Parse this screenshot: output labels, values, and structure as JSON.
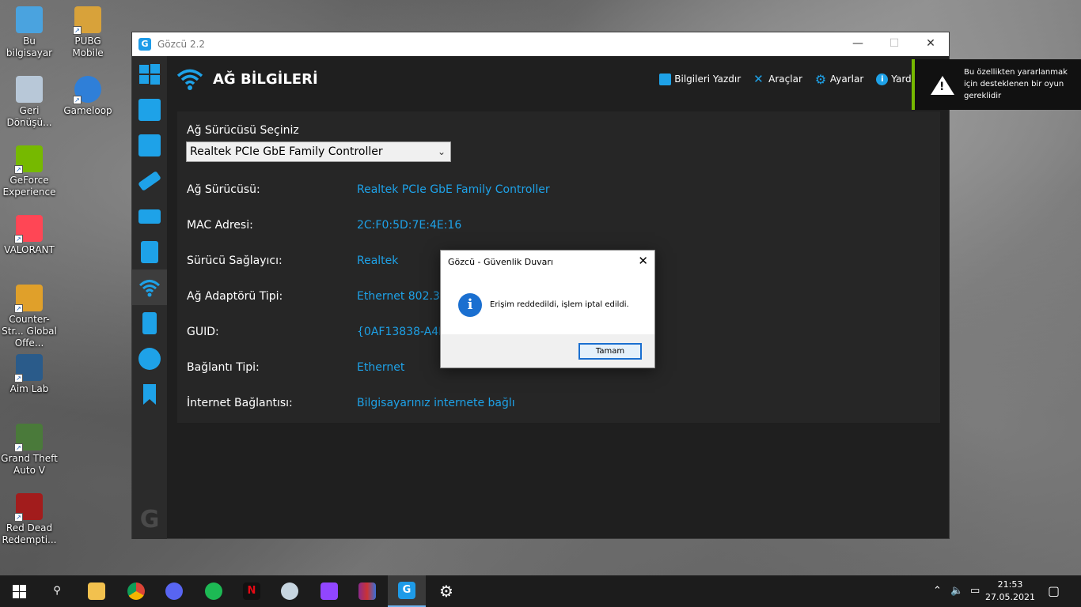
{
  "desktop": {
    "icons": [
      {
        "label": "Bu bilgisayar",
        "color": "#4aa3df"
      },
      {
        "label": "PUBG Mobile",
        "color": "#d8a23a"
      },
      {
        "label": "Geri Dönüşü...",
        "color": "#b8c8d8"
      },
      {
        "label": "Gameloop",
        "color": "#2f7fd8"
      },
      {
        "label": "GeForce Experience",
        "color": "#76b900"
      },
      {
        "label": "VALORANT",
        "color": "#ff4655"
      },
      {
        "label": "Counter-Str... Global Offe...",
        "color": "#e0a02a"
      },
      {
        "label": "Aim Lab",
        "color": "#2a5b8a"
      },
      {
        "label": "Grand Theft Auto V",
        "color": "#4a7a3a"
      },
      {
        "label": "Red Dead Redempti...",
        "color": "#a21c1c"
      }
    ]
  },
  "window": {
    "title": "Gözcü 2.2",
    "logo_letter": "G",
    "header": {
      "page_title": "AĞ BİLGİLERİ",
      "toolbar": [
        "Bilgileri Yazdır",
        "Araçlar",
        "Ayarlar",
        "Yardı"
      ]
    },
    "select": {
      "label": "Ağ Sürücüsü Seçiniz",
      "value": "Realtek PCIe GbE Family Controller"
    },
    "rows": [
      {
        "key": "Ağ Sürücüsü:",
        "value": "Realtek PCIe GbE Family Controller"
      },
      {
        "key": "MAC Adresi:",
        "value": "2C:F0:5D:7E:4E:16"
      },
      {
        "key": "Sürücü Sağlayıcı:",
        "value": "Realtek"
      },
      {
        "key": "Ağ Adaptörü Tipi:",
        "value": "Ethernet 802.3"
      },
      {
        "key": "GUID:",
        "value": "{0AF13838-A4D"
      },
      {
        "key": "Bağlantı Tipi:",
        "value": "Ethernet"
      },
      {
        "key": "İnternet Bağlantısı:",
        "value": "Bilgisayarınız internete bağlı"
      }
    ]
  },
  "dialog": {
    "title": "Gözcü - Güvenlik Duvarı",
    "message": "Erişim reddedildi, işlem iptal edildi.",
    "ok_label": "Tamam"
  },
  "toast": {
    "text": "Bu özellikten yararlanmak için desteklenen bir oyun gereklidir"
  },
  "taskbar": {
    "time": "21:53",
    "date": "27.05.2021"
  }
}
